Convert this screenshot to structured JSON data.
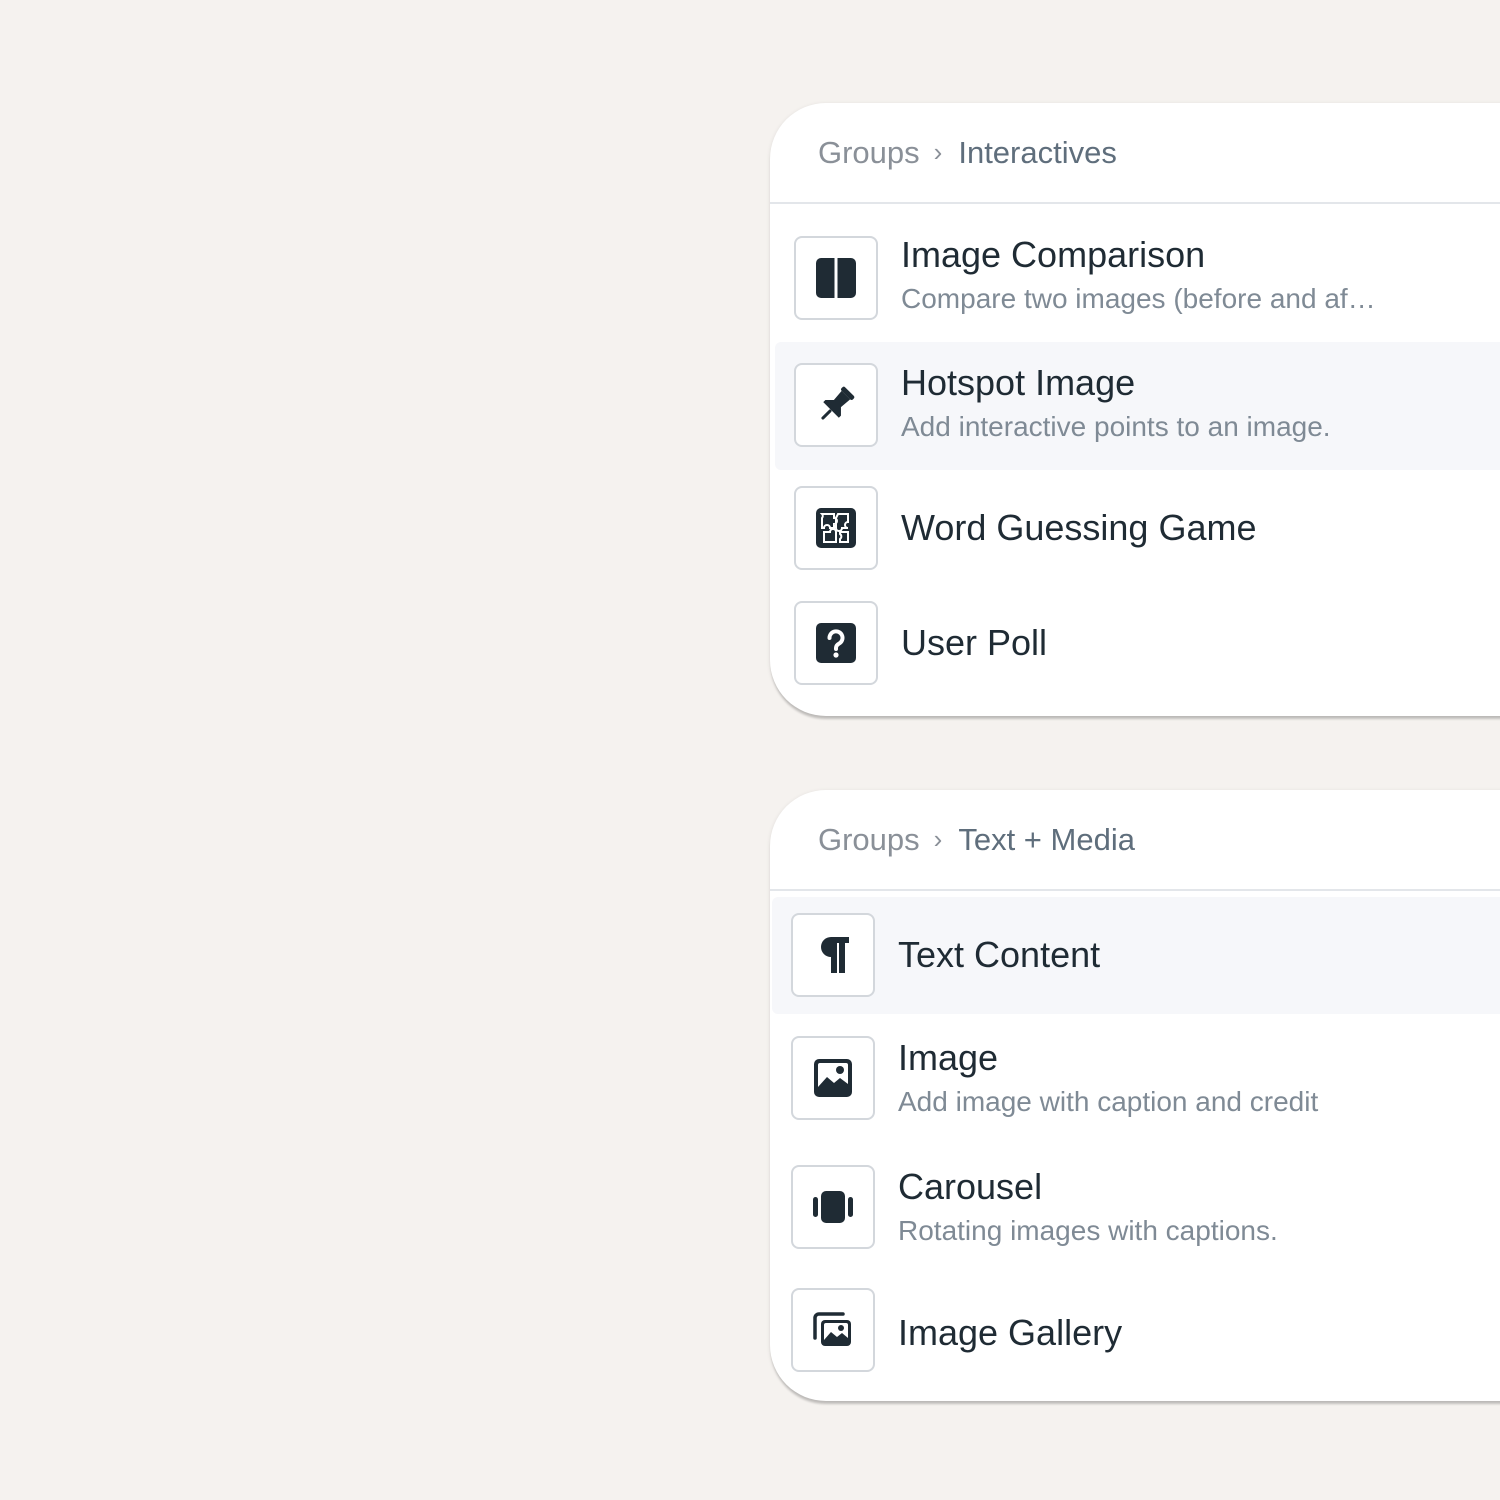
{
  "groups": [
    {
      "breadcrumb": {
        "root": "Groups",
        "separator": "›",
        "current": "Interactives"
      },
      "items": [
        {
          "title": "Image Comparison",
          "description": "Compare two images (before and af…",
          "icon": "split-square-icon"
        },
        {
          "title": "Hotspot Image",
          "description": "Add interactive points to an image.",
          "icon": "pushpin-icon"
        },
        {
          "title": "Word Guessing Game",
          "description": "",
          "icon": "puzzle-icon"
        },
        {
          "title": "User Poll",
          "description": "",
          "icon": "question-square-icon"
        }
      ]
    },
    {
      "breadcrumb": {
        "root": "Groups",
        "separator": "›",
        "current": "Text + Media"
      },
      "items": [
        {
          "title": "Text Content",
          "description": "",
          "icon": "pilcrow-icon"
        },
        {
          "title": "Image",
          "description": "Add image with caption and credit",
          "icon": "image-icon"
        },
        {
          "title": "Carousel",
          "description": "Rotating images with captions.",
          "icon": "carousel-icon"
        },
        {
          "title": "Image Gallery",
          "description": "",
          "icon": "gallery-icon"
        }
      ]
    }
  ],
  "colors": {
    "background": "#f5f2ef",
    "panel": "#ffffff",
    "highlight": "#f6f7fa",
    "icon": "#1f2b34",
    "title": "#1f2b34",
    "description": "#7f8a95",
    "breadcrumb_root": "#8a9098",
    "breadcrumb_current": "#5f6e7c"
  }
}
